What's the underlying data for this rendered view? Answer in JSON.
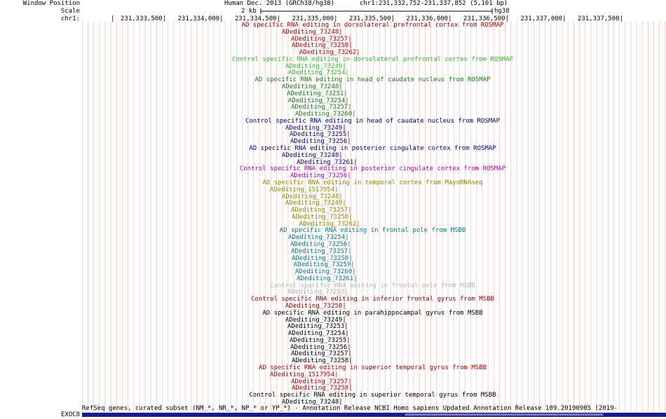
{
  "side_labels": {
    "window_position": "Window Position",
    "scale": "Scale",
    "chrom": "chr1:",
    "gene": "EXOC8"
  },
  "header": {
    "assembly": "Human Dec. 2013 (GRCh38/hg38)",
    "position": "chr1:231,332,752-231,337,852 (5,101 bp)",
    "scale_label": "2 kb",
    "scale_assembly": "hg38"
  },
  "ruler": {
    "ticks": [
      "231,333,500",
      "231,334,000",
      "231,334,500",
      "231,335,000",
      "231,335,500",
      "231,336,000",
      "231,336,500",
      "231,337,000",
      "231,337,500"
    ]
  },
  "colors": {
    "dlpfc_ad": "#b30000",
    "dlpfc_ctrl": "#2eb82e",
    "caudate_ad": "#1a7a1a",
    "caudate_ctrl": "#000080",
    "pcc_ad": "#000080",
    "pcc_ctrl": "#b300b3",
    "temporal": "#8c8c00",
    "frontal_pole": "#007a8c",
    "frontal_pole_ctrl": "#b3b3b3",
    "ifg": "#8c0000",
    "phg": "#000000",
    "stg_ad": "#b30000",
    "stg_ctrl": "#000000",
    "refseq": "#000080"
  },
  "tracks": [
    {
      "title": "AD specific RNA editing in dorsolateral prefrontal cortex from ROSMAP",
      "color": "#b30000",
      "items": [
        "ADediting_73248",
        "ADediting_73257",
        "ADediting_73258",
        "ADediting_73262"
      ]
    },
    {
      "title": "Control specific RNA editing in dorsolateral prefrontal cortex from ROSMAP",
      "color": "#2eb82e",
      "items": [
        "ADediting_73249",
        "ADediting_73254"
      ]
    },
    {
      "title": "AD specific RNA editing in head of caudate nucleus from ROSMAP",
      "color": "#1a7a1a",
      "items": [
        "ADediting_73248",
        "ADediting_73251",
        "ADediting_73254",
        "ADediting_73257",
        "ADediting_73260"
      ]
    },
    {
      "title": "Control specific RNA editing in head of caudate nucleus from ROSMAP",
      "color": "#000080",
      "items": [
        "ADediting_73249",
        "ADediting_73255",
        "ADediting_73256"
      ]
    },
    {
      "title": "AD specific RNA editing in posterior cingulate cortex from ROSMAP",
      "color": "#000080",
      "items": [
        "ADediting_73248",
        "ADediting_73261"
      ]
    },
    {
      "title": "Control specific RNA editing in posterior cingulate cortex from ROSMAP",
      "color": "#b300b3",
      "items": [
        "ADediting_73256"
      ]
    },
    {
      "title": "AD specific RNA editing in temporal cortex from MayoRNAseq",
      "color": "#8c8c00",
      "items": [
        "ADediting_1517954",
        "ADediting_73248",
        "ADediting_73249",
        "ADediting_73257",
        "ADediting_73258",
        "ADediting_73262"
      ]
    },
    {
      "title": "AD specific RNA editing in frontal pole from MSBB",
      "color": "#007a8c",
      "items": [
        "ADediting_73254",
        "ADediting_73256",
        "ADediting_73257",
        "ADediting_73258",
        "ADediting_73259",
        "ADediting_73260",
        "ADediting_73261"
      ]
    },
    {
      "title": "Control specific RNA editing in frontal pole from MSBB",
      "color": "#b3b3b3",
      "items": [
        "ADediting_73253"
      ]
    },
    {
      "title": "Control specific RNA editing in inferior frontal gyrus from MSBB",
      "color": "#8c0000",
      "items": [
        "ADediting_73250"
      ]
    },
    {
      "title": "AD specific RNA editing in parahippocampal gyrus from MSBB",
      "color": "#000000",
      "items": [
        "ADediting_73249",
        "ADediting_73253",
        "ADediting_73254",
        "ADediting_73255",
        "ADediting_73256",
        "ADediting_73257",
        "ADediting_73258"
      ]
    },
    {
      "title": "AD specific RNA editing in superior temporal gyrus from MSBB",
      "color": "#b30000",
      "items": [
        "ADediting_1517954",
        "ADediting_73257",
        "ADediting_73258"
      ]
    },
    {
      "title": "Control specific RNA editing in superior temporal gyrus from MSBB",
      "color": "#000000",
      "items": [
        "ADediting_73248"
      ]
    }
  ],
  "refseq": {
    "title": "RefSeq genes, curated subset (NM_*, NR_*, NP_* or YP_*) - Annotation Release NCBI Homo sapiens Updated Annotation Release 109.20190905 (2019-",
    "arrows": "<<<<<<<<<<<<<<<<<<<<<<<<<<<<<<<<<<<<<<<<<<<<<<<<<<<<<<<<<<<<<<<<<<<<<<<<<<<<<<<<<<<<<<<<"
  }
}
